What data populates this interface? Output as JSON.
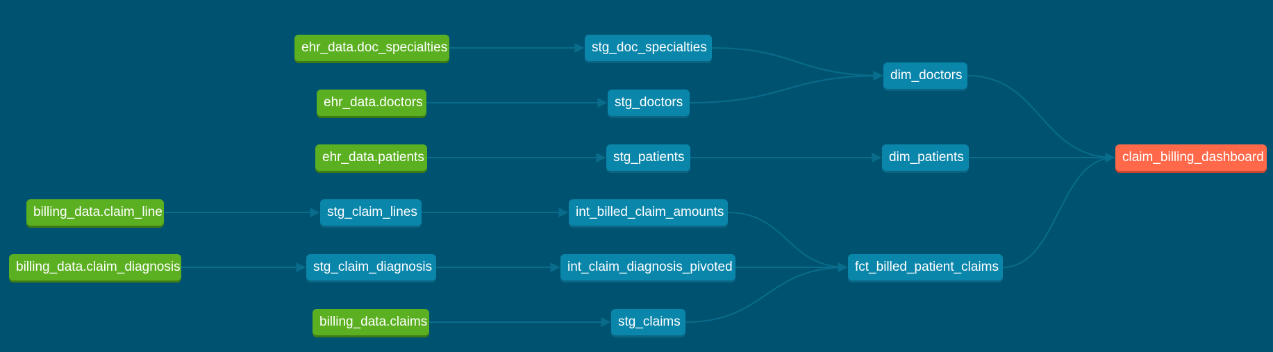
{
  "colors": {
    "background": "#005370",
    "source": "#5bb021",
    "model": "#0b86ab",
    "exposure": "#ff694a",
    "edge": "#0a6f8e"
  },
  "nodes": [
    {
      "id": "ehr_doc_specialties",
      "label": "ehr_data.doc_specialties",
      "kind": "source"
    },
    {
      "id": "ehr_doctors",
      "label": "ehr_data.doctors",
      "kind": "source"
    },
    {
      "id": "ehr_patients",
      "label": "ehr_data.patients",
      "kind": "source"
    },
    {
      "id": "billing_claim_line",
      "label": "billing_data.claim_line",
      "kind": "source"
    },
    {
      "id": "billing_claim_diagnosis",
      "label": "billing_data.claim_diagnosis",
      "kind": "source"
    },
    {
      "id": "billing_claims",
      "label": "billing_data.claims",
      "kind": "source"
    },
    {
      "id": "stg_doc_specialties",
      "label": "stg_doc_specialties",
      "kind": "model"
    },
    {
      "id": "stg_doctors",
      "label": "stg_doctors",
      "kind": "model"
    },
    {
      "id": "stg_patients",
      "label": "stg_patients",
      "kind": "model"
    },
    {
      "id": "stg_claim_lines",
      "label": "stg_claim_lines",
      "kind": "model"
    },
    {
      "id": "stg_claim_diagnosis",
      "label": "stg_claim_diagnosis",
      "kind": "model"
    },
    {
      "id": "stg_claims",
      "label": "stg_claims",
      "kind": "model"
    },
    {
      "id": "int_billed_claim_amounts",
      "label": "int_billed_claim_amounts",
      "kind": "model"
    },
    {
      "id": "int_claim_diagnosis_pivoted",
      "label": "int_claim_diagnosis_pivoted",
      "kind": "model"
    },
    {
      "id": "dim_doctors",
      "label": "dim_doctors",
      "kind": "model"
    },
    {
      "id": "dim_patients",
      "label": "dim_patients",
      "kind": "model"
    },
    {
      "id": "fct_billed_patient_claims",
      "label": "fct_billed_patient_claims",
      "kind": "model"
    },
    {
      "id": "claim_billing_dashboard",
      "label": "claim_billing_dashboard",
      "kind": "exposure"
    }
  ],
  "edges": [
    [
      "ehr_doc_specialties",
      "stg_doc_specialties"
    ],
    [
      "ehr_doctors",
      "stg_doctors"
    ],
    [
      "ehr_patients",
      "stg_patients"
    ],
    [
      "billing_claim_line",
      "stg_claim_lines"
    ],
    [
      "billing_claim_diagnosis",
      "stg_claim_diagnosis"
    ],
    [
      "billing_claims",
      "stg_claims"
    ],
    [
      "stg_doc_specialties",
      "dim_doctors"
    ],
    [
      "stg_doctors",
      "dim_doctors"
    ],
    [
      "stg_patients",
      "dim_patients"
    ],
    [
      "stg_claim_lines",
      "int_billed_claim_amounts"
    ],
    [
      "stg_claim_diagnosis",
      "int_claim_diagnosis_pivoted"
    ],
    [
      "int_billed_claim_amounts",
      "fct_billed_patient_claims"
    ],
    [
      "int_claim_diagnosis_pivoted",
      "fct_billed_patient_claims"
    ],
    [
      "stg_claims",
      "fct_billed_patient_claims"
    ],
    [
      "dim_doctors",
      "claim_billing_dashboard"
    ],
    [
      "dim_patients",
      "claim_billing_dashboard"
    ],
    [
      "fct_billed_patient_claims",
      "claim_billing_dashboard"
    ]
  ]
}
